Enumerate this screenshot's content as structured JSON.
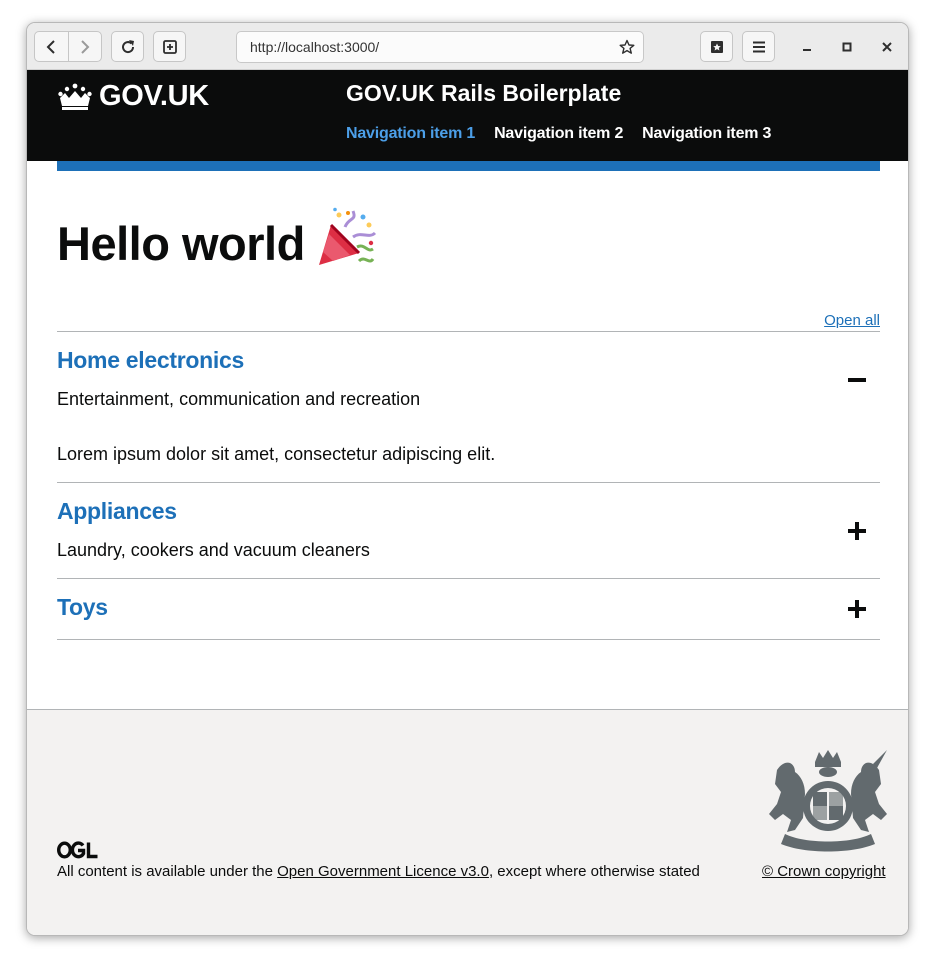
{
  "browser": {
    "url": "http://localhost:3000/"
  },
  "header": {
    "logo_text": "GOV.UK",
    "service_name": "GOV.UK Rails Boilerplate",
    "nav": [
      {
        "label": "Navigation item 1",
        "active": true
      },
      {
        "label": "Navigation item 2",
        "active": false
      },
      {
        "label": "Navigation item 3",
        "active": false
      }
    ]
  },
  "main": {
    "title": "Hello world",
    "title_emoji": "party-popper-icon",
    "open_all": "Open all",
    "sections": [
      {
        "heading": "Home electronics",
        "summary": "Entertainment, communication and recreation",
        "content": "Lorem ipsum dolor sit amet, consectetur adipiscing elit.",
        "expanded": true
      },
      {
        "heading": "Appliances",
        "summary": "Laundry, cookers and vacuum cleaners",
        "expanded": false
      },
      {
        "heading": "Toys",
        "expanded": false
      }
    ]
  },
  "footer": {
    "licence_prefix": "All content is available under the ",
    "licence_link": "Open Government Licence v3.0",
    "licence_suffix": ", except where otherwise stated",
    "copyright": "© Crown copyright"
  },
  "colors": {
    "header_bg": "#0b0c0c",
    "brand_blue": "#1d70b8",
    "footer_bg": "#f3f2f1"
  }
}
